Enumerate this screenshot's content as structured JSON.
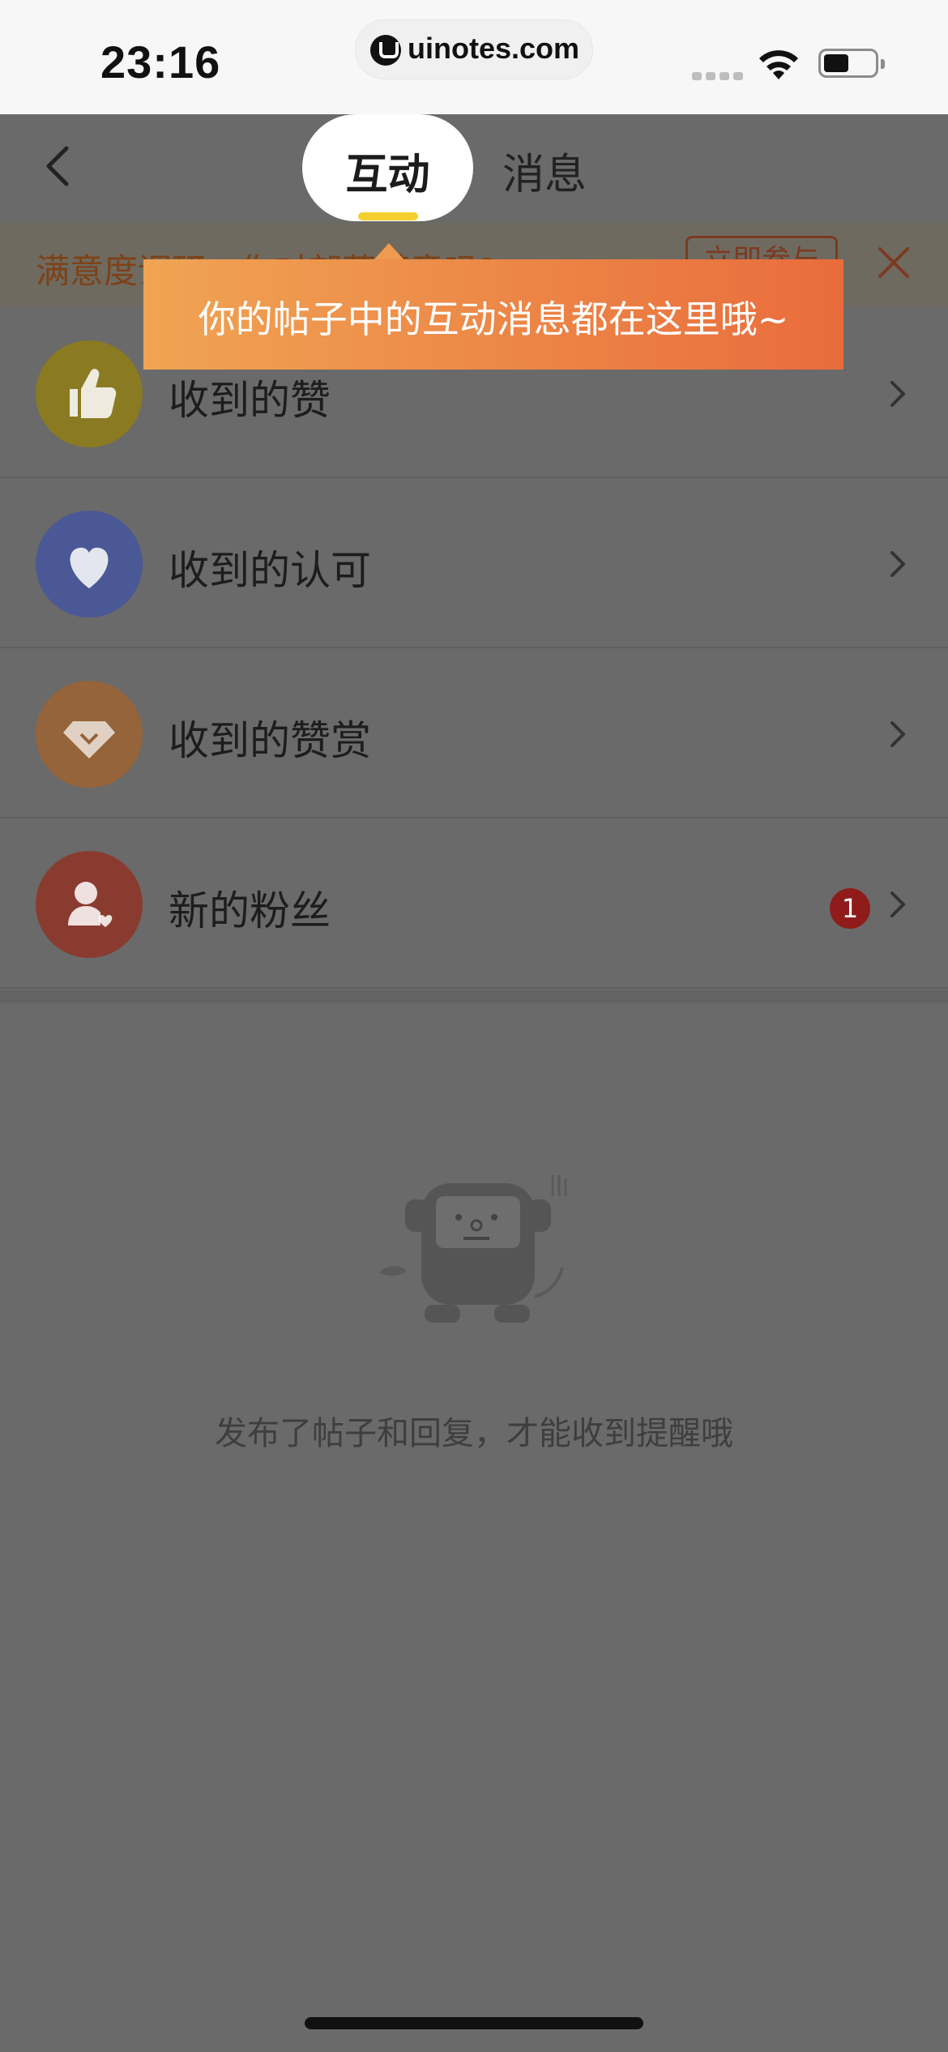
{
  "status_bar": {
    "time": "23:16",
    "url": "uinotes.com",
    "icons": [
      "signal-icon",
      "wifi-icon",
      "battery-icon"
    ]
  },
  "nav": {
    "back_icon": "chevron-left-icon",
    "tabs": [
      {
        "label": "互动",
        "active": true
      },
      {
        "label": "消息",
        "active": false
      }
    ]
  },
  "survey": {
    "text": "满意度调研：你对部落满意吗?",
    "button": "立即参与",
    "close_icon": "close-icon"
  },
  "tooltip": {
    "text": "你的帖子中的互动消息都在这里哦~"
  },
  "list": [
    {
      "label": "收到的赞",
      "icon": "thumbs-up-icon",
      "color": "#8a7a22"
    },
    {
      "label": "收到的认可",
      "icon": "heart-icon",
      "color": "#4a5896"
    },
    {
      "label": "收到的赞赏",
      "icon": "diamond-icon",
      "color": "#96643a"
    },
    {
      "label": "新的粉丝",
      "icon": "user-heart-icon",
      "color": "#8a3b30",
      "badge": "1"
    }
  ],
  "empty_state": {
    "text": "发布了帖子和回复，才能收到提醒哦"
  },
  "colors": {
    "overlay": "#6a6a6a",
    "tab_indicator": "#f4cf2f",
    "tooltip_start": "#f0a453",
    "tooltip_end": "#e96c3c",
    "badge": "#8f1c1a"
  }
}
